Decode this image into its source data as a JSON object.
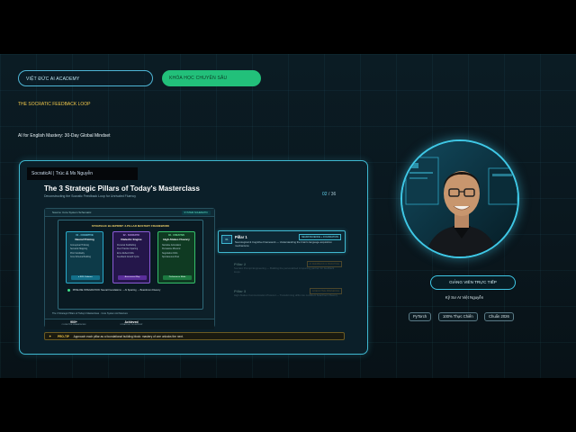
{
  "header": {
    "academy_label": "VIỆT ĐỨC AI ACADEMY",
    "status_label": "KHÓA HỌC CHUYÊN SÂU",
    "tagline": "THE SOCRATIC FEEDBACK LOOP",
    "subtitle": "AI for English Mastery: 30-Day Global Mindset"
  },
  "slide": {
    "presenter_tag": "SocraticAI | Trúc & Ms Nguyễn",
    "title": "The 3 Strategic Pillars of Today's Masterclass",
    "subtitle": "Deconstructing the Socratic Feedback Loop for Unrivaled Fluency",
    "page_current": "02",
    "page_sep": "/",
    "page_total": "36",
    "diagram": {
      "source_label": "Source: Core System Schematic",
      "badge": "SYSTEM SCHEMATIC",
      "title": "STRATEGIC BLUEPRINT: 3-PILLAR MASTERY FRAMEWORK",
      "columns": [
        {
          "head": "01 · COGNITIVE",
          "sub": "Neural Priming",
          "items": [
            "Conceptual Thinking",
            "Semantic Mapping",
            "Prior Familiarity",
            "Core Schema Building"
          ],
          "button": "▸ 80% Cadence"
        },
        {
          "head": "02 · SOCRATIC",
          "sub": "Dialectic Engine",
          "items": [
            "Personal Scaffolding",
            "Peer Practice Sparring",
            "Error-Reflect Drills",
            "Feedback Growth Cycle"
          ],
          "button": "Assessment Map"
        },
        {
          "head": "03 · CREATIVE",
          "sub": "High-Stakes Fluency",
          "items": [
            "Narrative Articulation",
            "Persuasive Rhetoric",
            "Negotiation Drills",
            "Spontaneous Flow"
          ],
          "button": "Performance Mode"
        }
      ],
      "pipeline": "PIPELINE INTEGRATION: Neural Foundations → AI Sparring → Boardroom Fluency",
      "caption": "The 3 Strategic Pillars of Today's Masterclass · Core System Architecture",
      "stats": [
        {
          "value": "900+",
          "label": "COGNITIVE FRAMEWORK"
        },
        {
          "value": "Achieved",
          "label": "STRATEGIC BLUEPRINT"
        }
      ]
    },
    "pillars": [
      {
        "num": "01",
        "name": "Pillar 1",
        "tag": "NEUROSCIENCE + FOUNDATION",
        "desc": "Neurological & Cognitive Framework — Understanding the brain's language acquisition mechanisms"
      },
      {
        "num": "02",
        "name": "Pillar 2",
        "tag": "AI FEEDBACK & PRACTICE",
        "desc": "Socratic Prompt Engineering — Building the personalized AI sparring partner for feedback loops"
      },
      {
        "num": "03",
        "name": "Pillar 3",
        "tag": "EXECUTIVE PRESENCE",
        "desc": "High-Stakes Communication Protocol — Transforming drills into confident boardroom fluency"
      }
    ],
    "pro_tip": {
      "label": "PRO-TIP",
      "text": "Approach each pillar as a foundational building block: mastery of one unlocks the next."
    }
  },
  "presenter": {
    "name": "GIẢNG VIÊN TRỰC TIẾP",
    "role": "Kỹ Sư AI Việt Nguyễn",
    "chips": [
      "PyTorch",
      "100% Thực Chiến",
      "Chuẩn 2026"
    ]
  },
  "colors": {
    "accent": "#3fb8d0",
    "brand_green": "#22c07a",
    "gold": "#f2c84a",
    "purple": "#8a5ad6"
  }
}
